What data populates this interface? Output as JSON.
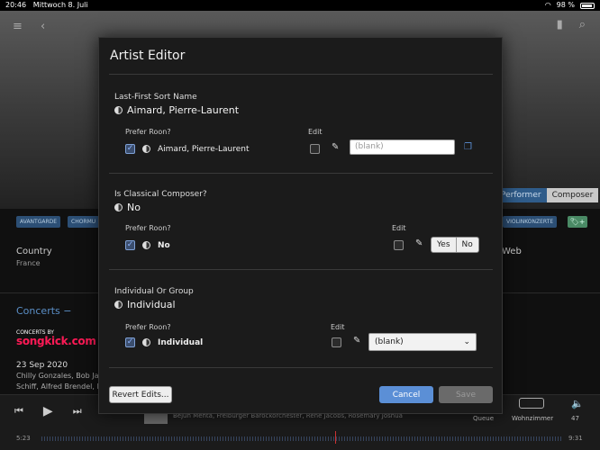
{
  "statusbar": {
    "time": "20:46",
    "date": "Mittwoch 8. Juli",
    "battery": "98 %"
  },
  "background": {
    "role_toggle": [
      "Performer",
      "Composer"
    ],
    "genres": [
      "AVANTGARDE",
      "CHORMU",
      "VIOLINKONZERTE"
    ],
    "country_label": "Country",
    "country_value": "France",
    "web_label": "Web",
    "concerts_title": "Concerts",
    "concerts_by": "CONCERTS BY",
    "songkick": "songkick.com",
    "concert_date": "23 Sep 2020",
    "concert_line1": "Chilly Gonzales, Bob Jam",
    "concert_line2": "Schiff, Alfred Brendel, H"
  },
  "player": {
    "now_playing": "Bejun Mehta, Freiburger Barockorchester, René Jacobs, Rosemary Joshua",
    "queue_label": "Queue",
    "zone_label": "Wohnzimmer",
    "volume": "47",
    "time_start": "5:23",
    "time_end": "9:31"
  },
  "modal": {
    "title": "Artist Editor",
    "sections": [
      {
        "label": "Last-First Sort Name",
        "value": "Aimard, Pierre-Laurent",
        "prefer_label": "Prefer Roon?",
        "prefer_value": "Aimard, Pierre-Laurent",
        "edit_label": "Edit",
        "input_placeholder": "(blank)"
      },
      {
        "label": "Is Classical Composer?",
        "value": "No",
        "prefer_label": "Prefer Roon?",
        "prefer_value": "No",
        "edit_label": "Edit",
        "options": [
          "Yes",
          "No"
        ]
      },
      {
        "label": "Individual Or Group",
        "value": "Individual",
        "prefer_label": "Prefer Roon?",
        "prefer_value": "Individual",
        "edit_label": "Edit",
        "select_value": "(blank)"
      }
    ],
    "revert_label": "Revert Edits...",
    "cancel_label": "Cancel",
    "save_label": "Save"
  }
}
